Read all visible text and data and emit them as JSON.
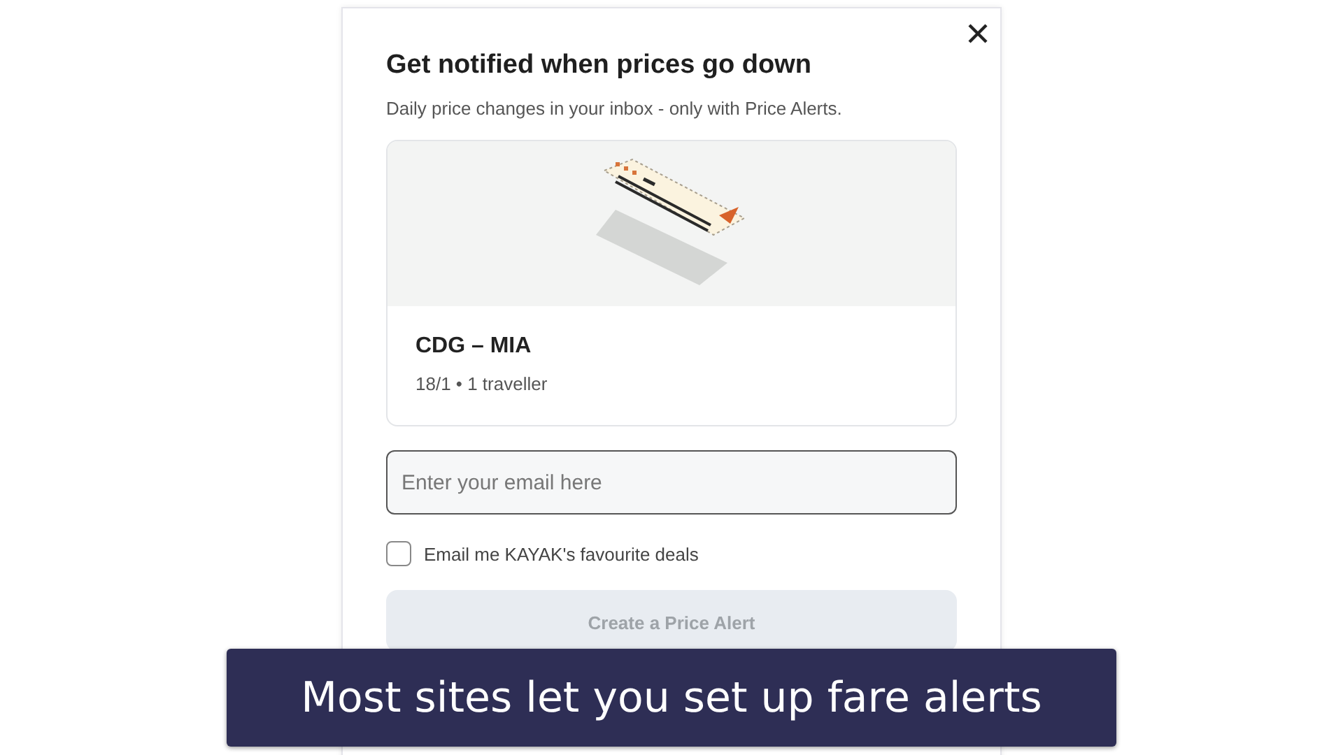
{
  "dialog": {
    "title": "Get notified when prices go down",
    "subtitle": "Daily price changes in your inbox - only with Price Alerts.",
    "route_card": {
      "route": "CDG – MIA",
      "details": "18/1 • 1 traveller"
    },
    "email_field": {
      "placeholder": "Enter your email here"
    },
    "deals_checkbox": {
      "label": "Email me KAYAK's favourite deals",
      "checked": false
    },
    "create_button": {
      "label": "Create a Price Alert",
      "disabled": true
    }
  },
  "caption": "Most sites let you set up fare alerts"
}
